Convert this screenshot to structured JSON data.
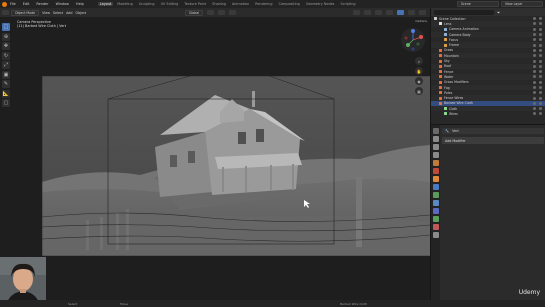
{
  "topbar": {
    "menu": [
      "File",
      "Edit",
      "Render",
      "Window",
      "Help"
    ],
    "workspaces": [
      "Layout",
      "Modeling",
      "Sculpting",
      "UV Editing",
      "Texture Paint",
      "Shading",
      "Animation",
      "Rendering",
      "Compositing",
      "Geometry Nodes",
      "Scripting"
    ],
    "active_workspace": "Layout",
    "scene_label": "Scene",
    "view_layer_label": "View Layer"
  },
  "viewport": {
    "mode_label": "Object Mode",
    "menus": [
      "View",
      "Select",
      "Add",
      "Object"
    ],
    "transform_label": "Global",
    "camera_title": "Camera Perspective",
    "camera_subtitle": "(11) Barbed Wire Cloth | Vert",
    "options_label": "Options"
  },
  "outliner": {
    "title": "Scene Collection",
    "rows": [
      {
        "label": "Scene Collection",
        "icon_color": "#cfcfcf",
        "indent": 0
      },
      {
        "label": "Lens",
        "icon_color": "#e0e0e0",
        "indent": 1
      },
      {
        "label": "Camera Animation",
        "icon_color": "#8fb3d9",
        "indent": 2
      },
      {
        "label": "Camera Body",
        "icon_color": "#8fb3d9",
        "indent": 2
      },
      {
        "label": "Focus",
        "icon_color": "#e0a040",
        "indent": 2
      },
      {
        "label": "Frame",
        "icon_color": "#e0a040",
        "indent": 2
      },
      {
        "label": "Grass",
        "icon_color": "#e07040",
        "indent": 1
      },
      {
        "label": "Mountain",
        "icon_color": "#e07040",
        "indent": 1
      },
      {
        "label": "Sky",
        "icon_color": "#e07040",
        "indent": 1
      },
      {
        "label": "Roof",
        "icon_color": "#e07040",
        "indent": 1
      },
      {
        "label": "Fence",
        "icon_color": "#e07040",
        "indent": 1
      },
      {
        "label": "Water",
        "icon_color": "#e07040",
        "indent": 1
      },
      {
        "label": "Grass Modifiers",
        "icon_color": "#e07040",
        "indent": 1
      },
      {
        "label": "Fog",
        "icon_color": "#e07040",
        "indent": 1
      },
      {
        "label": "Poles",
        "icon_color": "#e07040",
        "indent": 1
      },
      {
        "label": "Fence Wires",
        "icon_color": "#e07040",
        "indent": 1
      },
      {
        "label": "Barbed Wire Cloth",
        "icon_color": "#e07040",
        "indent": 1
      },
      {
        "label": "Cloth",
        "icon_color": "#8fd98f",
        "indent": 2
      },
      {
        "label": "Wires",
        "icon_color": "#8fd98f",
        "indent": 2
      }
    ]
  },
  "properties": {
    "object_name": "Vert",
    "add_modifier_label": "Add Modifier"
  },
  "status": {
    "left": "Select",
    "middle": "Move",
    "right": "Barbed Wire Cloth"
  },
  "watermark": "Udemy"
}
